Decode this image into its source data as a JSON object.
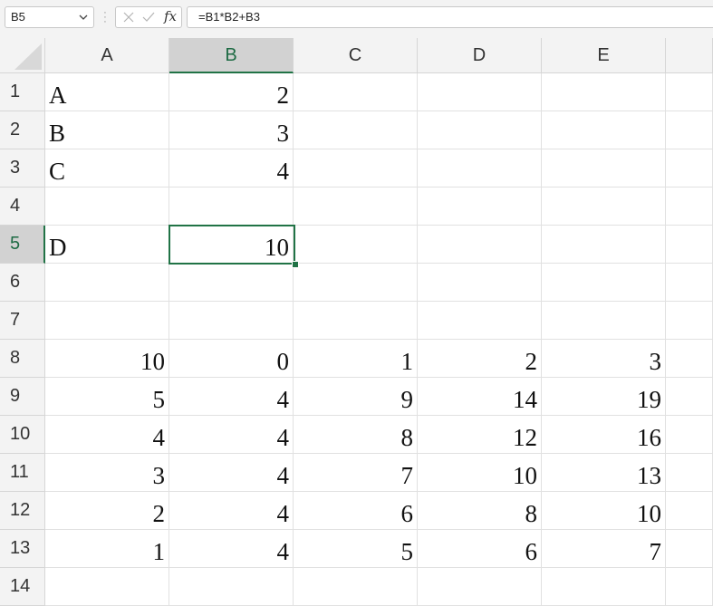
{
  "formula_bar": {
    "name_box": "B5",
    "fx_label": "fx",
    "formula": "=B1*B2+B3"
  },
  "columns": [
    "A",
    "B",
    "C",
    "D",
    "E"
  ],
  "rows": [
    {
      "n": "1",
      "cells": [
        "A",
        "2",
        "",
        "",
        ""
      ]
    },
    {
      "n": "2",
      "cells": [
        "B",
        "3",
        "",
        "",
        ""
      ]
    },
    {
      "n": "3",
      "cells": [
        "C",
        "4",
        "",
        "",
        ""
      ]
    },
    {
      "n": "4",
      "cells": [
        "",
        "",
        "",
        "",
        ""
      ]
    },
    {
      "n": "5",
      "cells": [
        "D",
        "10",
        "",
        "",
        ""
      ]
    },
    {
      "n": "6",
      "cells": [
        "",
        "",
        "",
        "",
        ""
      ]
    },
    {
      "n": "7",
      "cells": [
        "",
        "",
        "",
        "",
        ""
      ]
    },
    {
      "n": "8",
      "cells": [
        "10",
        "0",
        "1",
        "2",
        "3"
      ]
    },
    {
      "n": "9",
      "cells": [
        "5",
        "4",
        "9",
        "14",
        "19"
      ]
    },
    {
      "n": "10",
      "cells": [
        "4",
        "4",
        "8",
        "12",
        "16"
      ]
    },
    {
      "n": "11",
      "cells": [
        "3",
        "4",
        "7",
        "10",
        "13"
      ]
    },
    {
      "n": "12",
      "cells": [
        "2",
        "4",
        "6",
        "8",
        "10"
      ]
    },
    {
      "n": "13",
      "cells": [
        "1",
        "4",
        "5",
        "6",
        "7"
      ]
    },
    {
      "n": "14",
      "cells": [
        "",
        "",
        "",
        "",
        ""
      ]
    }
  ],
  "selection": {
    "column": "B",
    "row": "5"
  },
  "colors": {
    "accent": "#217346",
    "header_bg": "#f3f3f3",
    "header_selected_bg": "#d2d2d2",
    "gridline": "#e1e1e1"
  }
}
